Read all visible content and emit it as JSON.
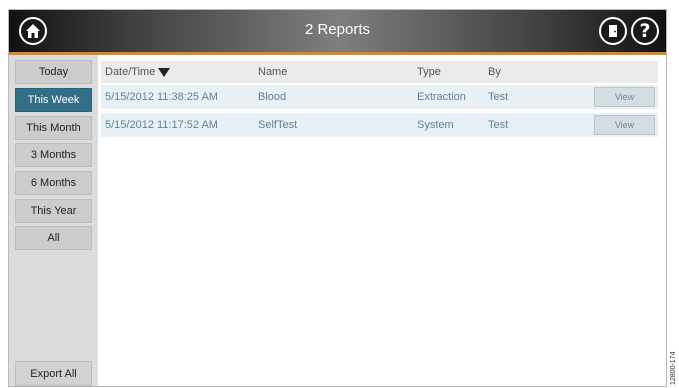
{
  "header": {
    "title": "2 Reports",
    "accent_color": "#d58b2c",
    "icons": {
      "home": "home-icon",
      "exit": "exit-door-icon",
      "help": "help-icon"
    },
    "help_glyph": "?"
  },
  "sidebar": {
    "filters": [
      {
        "label": "Today",
        "active": false
      },
      {
        "label": "This Week",
        "active": true
      },
      {
        "label": "This Month",
        "active": false
      },
      {
        "label": "3 Months",
        "active": false
      },
      {
        "label": "6 Months",
        "active": false
      },
      {
        "label": "This Year",
        "active": false
      },
      {
        "label": "All",
        "active": false
      }
    ],
    "export_label": "Export All",
    "active_color": "#336f87"
  },
  "table": {
    "columns": [
      "Date/Time",
      "Name",
      "Type",
      "By"
    ],
    "sort_icon": "sort-descending-icon",
    "rows": [
      {
        "datetime": "5/15/2012 11:38:25 AM",
        "name": "Blood",
        "type": "Extraction",
        "by": "Test",
        "action": "View"
      },
      {
        "datetime": "5/15/2012 11:17:52 AM",
        "name": "SelfTest",
        "type": "System",
        "by": "Test",
        "action": "View"
      }
    ]
  },
  "figure_id": "12800-174"
}
